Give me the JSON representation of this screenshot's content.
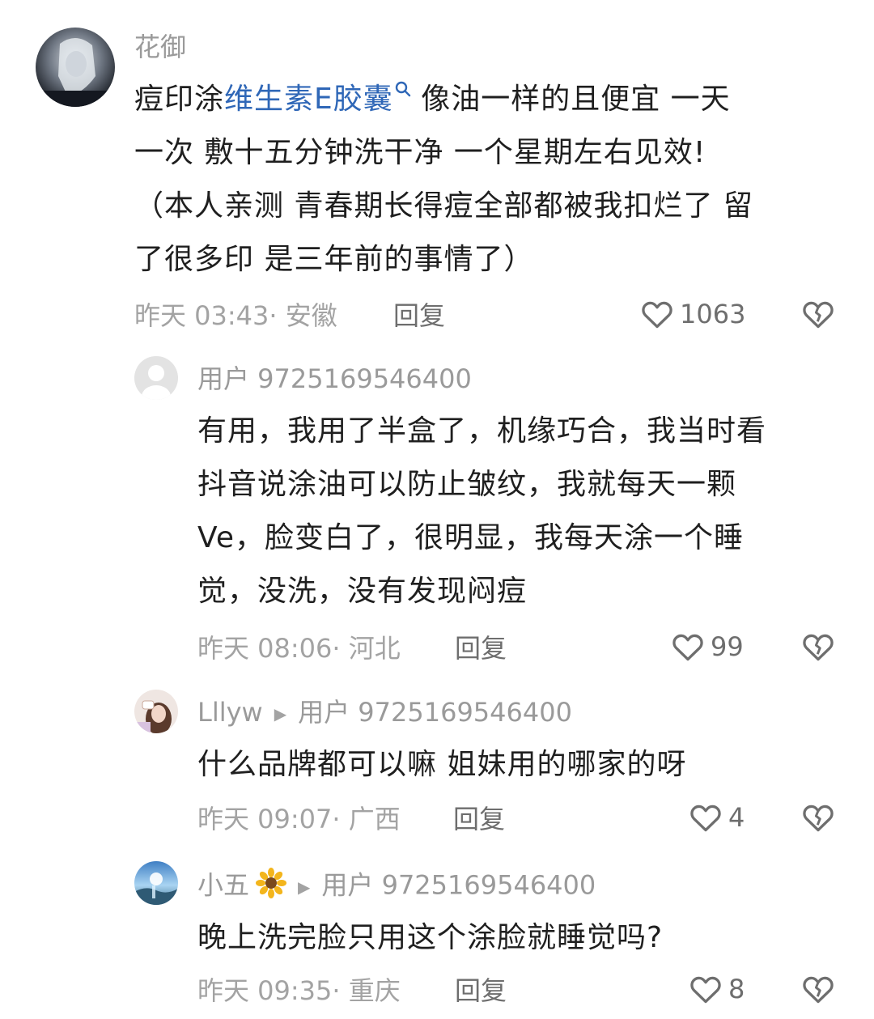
{
  "comments": [
    {
      "author": "花御",
      "text_prefix": "痘印涂",
      "link_text": "维生素E胶囊",
      "text_suffix": " 像油一样的且便宜 一天",
      "lines": [
        "一次 敷十五分钟洗干净 一个星期左右见效!",
        "（本人亲测 青春期长得痘全部都被我扣烂了 留",
        "了很多印 是三年前的事情了）"
      ],
      "meta": "昨天 03:43· 安徽",
      "reply_label": "回复",
      "likes": "1063"
    }
  ],
  "replies": [
    {
      "author": "用户 9725169546400",
      "lines": [
        "有用，我用了半盒了，机缘巧合，我当时看",
        "抖音说涂油可以防止皱纹，我就每天一颗",
        "Ve，脸变白了，很明显，我每天涂一个睡",
        "觉，没洗，没有发现闷痘"
      ],
      "meta": "昨天 08:06· 河北",
      "reply_label": "回复",
      "likes": "99"
    },
    {
      "author": "Lllyw",
      "reply_to": "用户 9725169546400",
      "lines": [
        "什么品牌都可以嘛 姐妹用的哪家的呀"
      ],
      "meta": "昨天 09:07· 广西",
      "reply_label": "回复",
      "likes": "4"
    },
    {
      "author": "小五",
      "author_emoji": "sunflower",
      "reply_to": "用户 9725169546400",
      "lines": [
        "晚上洗完脸只用这个涂脸就睡觉吗?"
      ],
      "meta": "昨天 09:35· 重庆",
      "reply_label": "回复",
      "likes": "8"
    }
  ],
  "icons": {
    "like": "heart-outline-icon",
    "dislike": "broken-heart-icon",
    "search": "search-icon",
    "reply_arrow": "play-arrow-icon"
  },
  "colors": {
    "link": "#2f67b7",
    "meta": "#a3a3a3",
    "action": "#6e6e6e"
  }
}
